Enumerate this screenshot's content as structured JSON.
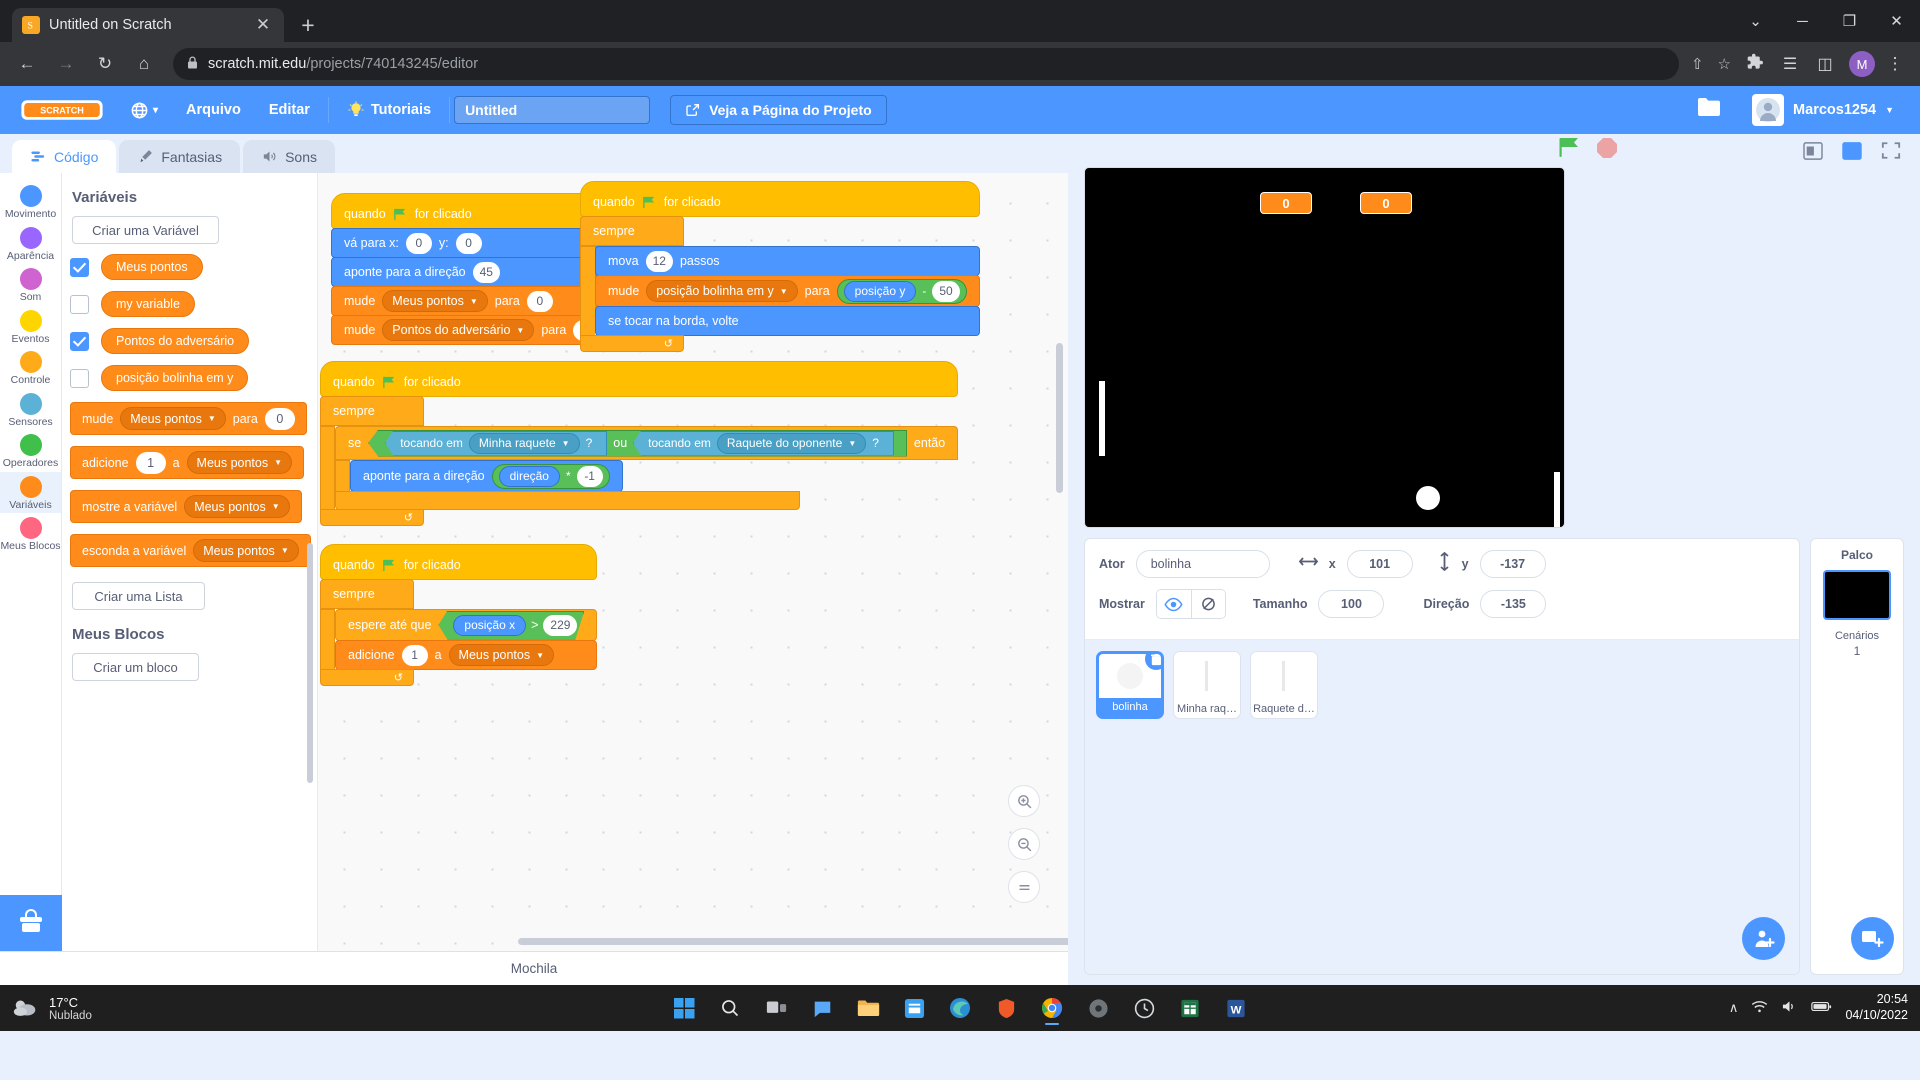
{
  "browser": {
    "tab_title": "Untitled on Scratch",
    "tab_close": "✕",
    "new_tab": "+",
    "url_prefix": "scratch.mit.edu",
    "url_suffix": "/projects/740143245/editor",
    "win_minimize": "─",
    "win_maximize": "❐",
    "win_close": "✕",
    "win_chevron": "⌄",
    "back": "←",
    "forward": "→",
    "reload": "↻",
    "home": "⌂",
    "lock": "🔒",
    "share_icon": "⇧",
    "star_icon": "☆",
    "extensions_icon": "🧩",
    "list_icon": "☰",
    "sidepanel_icon": "◫",
    "profile_initial": "M",
    "menu_dots": "⋮"
  },
  "scratch_menu": {
    "logo_text": "SCRATCH",
    "globe_arrow": "▾",
    "file": "Arquivo",
    "edit": "Editar",
    "tutorials": "Tutoriais",
    "project_name": "Untitled",
    "see_project_page": "Veja a Página do Projeto",
    "username": "Marcos1254"
  },
  "editor_tabs": [
    {
      "label": "Código",
      "icon": "code-icon",
      "active": true
    },
    {
      "label": "Fantasias",
      "icon": "brush-icon",
      "active": false
    },
    {
      "label": "Sons",
      "icon": "speaker-icon",
      "active": false
    }
  ],
  "categories": [
    {
      "label": "Movimento",
      "color": "#4c97ff",
      "selected": false
    },
    {
      "label": "Aparência",
      "color": "#9966ff",
      "selected": false
    },
    {
      "label": "Som",
      "color": "#cf63cf",
      "selected": false
    },
    {
      "label": "Eventos",
      "color": "#ffd500",
      "selected": false
    },
    {
      "label": "Controle",
      "color": "#ffab19",
      "selected": false
    },
    {
      "label": "Sensores",
      "color": "#5cb1d6",
      "selected": false
    },
    {
      "label": "Operadores",
      "color": "#40bf4a",
      "selected": false
    },
    {
      "label": "Variáveis",
      "color": "#ff8c1a",
      "selected": true
    },
    {
      "label": "Meus Blocos",
      "color": "#ff6680",
      "selected": false
    }
  ],
  "palette": {
    "heading": "Variáveis",
    "create_variable": "Criar uma Variável",
    "create_list": "Criar uma Lista",
    "my_blocks_heading": "Meus Blocos",
    "create_block": "Criar um bloco",
    "variables": [
      {
        "name": "Meus pontos",
        "checked": true
      },
      {
        "name": "my variable",
        "checked": false
      },
      {
        "name": "Pontos do adversário",
        "checked": true
      },
      {
        "name": "posição bolinha em y",
        "checked": false
      }
    ],
    "blocks": {
      "set_label": "mude",
      "set_var": "Meus pontos",
      "set_to": "para",
      "set_value": "0",
      "change_label": "adicione",
      "change_value": "1",
      "change_a": "a",
      "change_var": "Meus pontos",
      "show_label": "mostre a variável",
      "show_var": "Meus pontos",
      "hide_label": "esconda a variável",
      "hide_var": "Meus pontos"
    }
  },
  "scripts": {
    "s1": {
      "hat": {
        "when": "quando",
        "clicked": "for clicado"
      },
      "goto": {
        "label": "vá para x:",
        "x": "0",
        "ylabel": "y:",
        "y": "0"
      },
      "point": {
        "label": "aponte para a direção",
        "value": "45"
      },
      "set1": {
        "label": "mude",
        "var": "Meus pontos",
        "to": "para",
        "value": "0"
      },
      "set2": {
        "label": "mude",
        "var": "Pontos do adversário",
        "to": "para",
        "value": "0"
      }
    },
    "s2": {
      "hat": {
        "when": "quando",
        "clicked": "for clicado"
      },
      "forever": "sempre",
      "move": {
        "label": "mova",
        "value": "12",
        "steps": "passos"
      },
      "set": {
        "label": "mude",
        "var": "posição bolinha em y",
        "to": "para",
        "op_left": "posição y",
        "op": "-",
        "op_right": "50"
      },
      "bounce": "se tocar na borda, volte",
      "loop_arrow": "↺"
    },
    "s3": {
      "hat": {
        "when": "quando",
        "clicked": "for clicado"
      },
      "forever": "sempre",
      "if": {
        "label": "se",
        "then": "então",
        "touch1_label": "tocando em",
        "touch1_target": "Minha raquete",
        "q1": "?",
        "or": "ou",
        "touch2_label": "tocando em",
        "touch2_target": "Raquete do oponente",
        "q2": "?"
      },
      "point": {
        "label": "aponte para a direção",
        "var": "direção",
        "op": "*",
        "value": "-1"
      },
      "loop_arrow": "↺"
    },
    "s4": {
      "hat": {
        "when": "quando",
        "clicked": "for clicado"
      },
      "forever": "sempre",
      "wait": {
        "label": "espere até que",
        "left": "posição x",
        "op": ">",
        "right": "229"
      },
      "change": {
        "label": "adicione",
        "value": "1",
        "a": "a",
        "var": "Meus pontos"
      },
      "loop_arrow": "↺"
    }
  },
  "backpack_label": "Mochila",
  "stage": {
    "monitor_1": "0",
    "monitor_2": "0",
    "green_flag": "green-flag-icon",
    "stop": "stop-icon"
  },
  "sprite_info": {
    "actor_label": "Ator",
    "actor_name": "bolinha",
    "x_label": "x",
    "x_value": "101",
    "y_label": "y",
    "y_value": "-137",
    "show_label": "Mostrar",
    "size_label": "Tamanho",
    "size_value": "100",
    "direction_label": "Direção",
    "direction_value": "-135"
  },
  "sprites": [
    {
      "name": "bolinha",
      "selected": true,
      "thumb": "ball"
    },
    {
      "name": "Minha raq…",
      "selected": false,
      "thumb": "paddle"
    },
    {
      "name": "Raquete d…",
      "selected": false,
      "thumb": "paddle"
    }
  ],
  "stage_panel": {
    "title": "Palco",
    "backdrops_label": "Cenários",
    "backdrops_count": "1"
  },
  "taskbar": {
    "temp": "17°C",
    "condition": "Nublado",
    "time": "20:54",
    "date": "04/10/2022",
    "chevron_up": "∧",
    "wifi": "wifi-icon",
    "volume": "volume-icon",
    "battery": "battery-icon"
  },
  "colors": {
    "scratch_blue": "#4c97ff",
    "variables_orange": "#ff8c1a",
    "control_orange": "#ffab19",
    "events_yellow": "#ffbf00",
    "operators_green": "#59c059",
    "sensing_blue": "#5cb1d6"
  }
}
